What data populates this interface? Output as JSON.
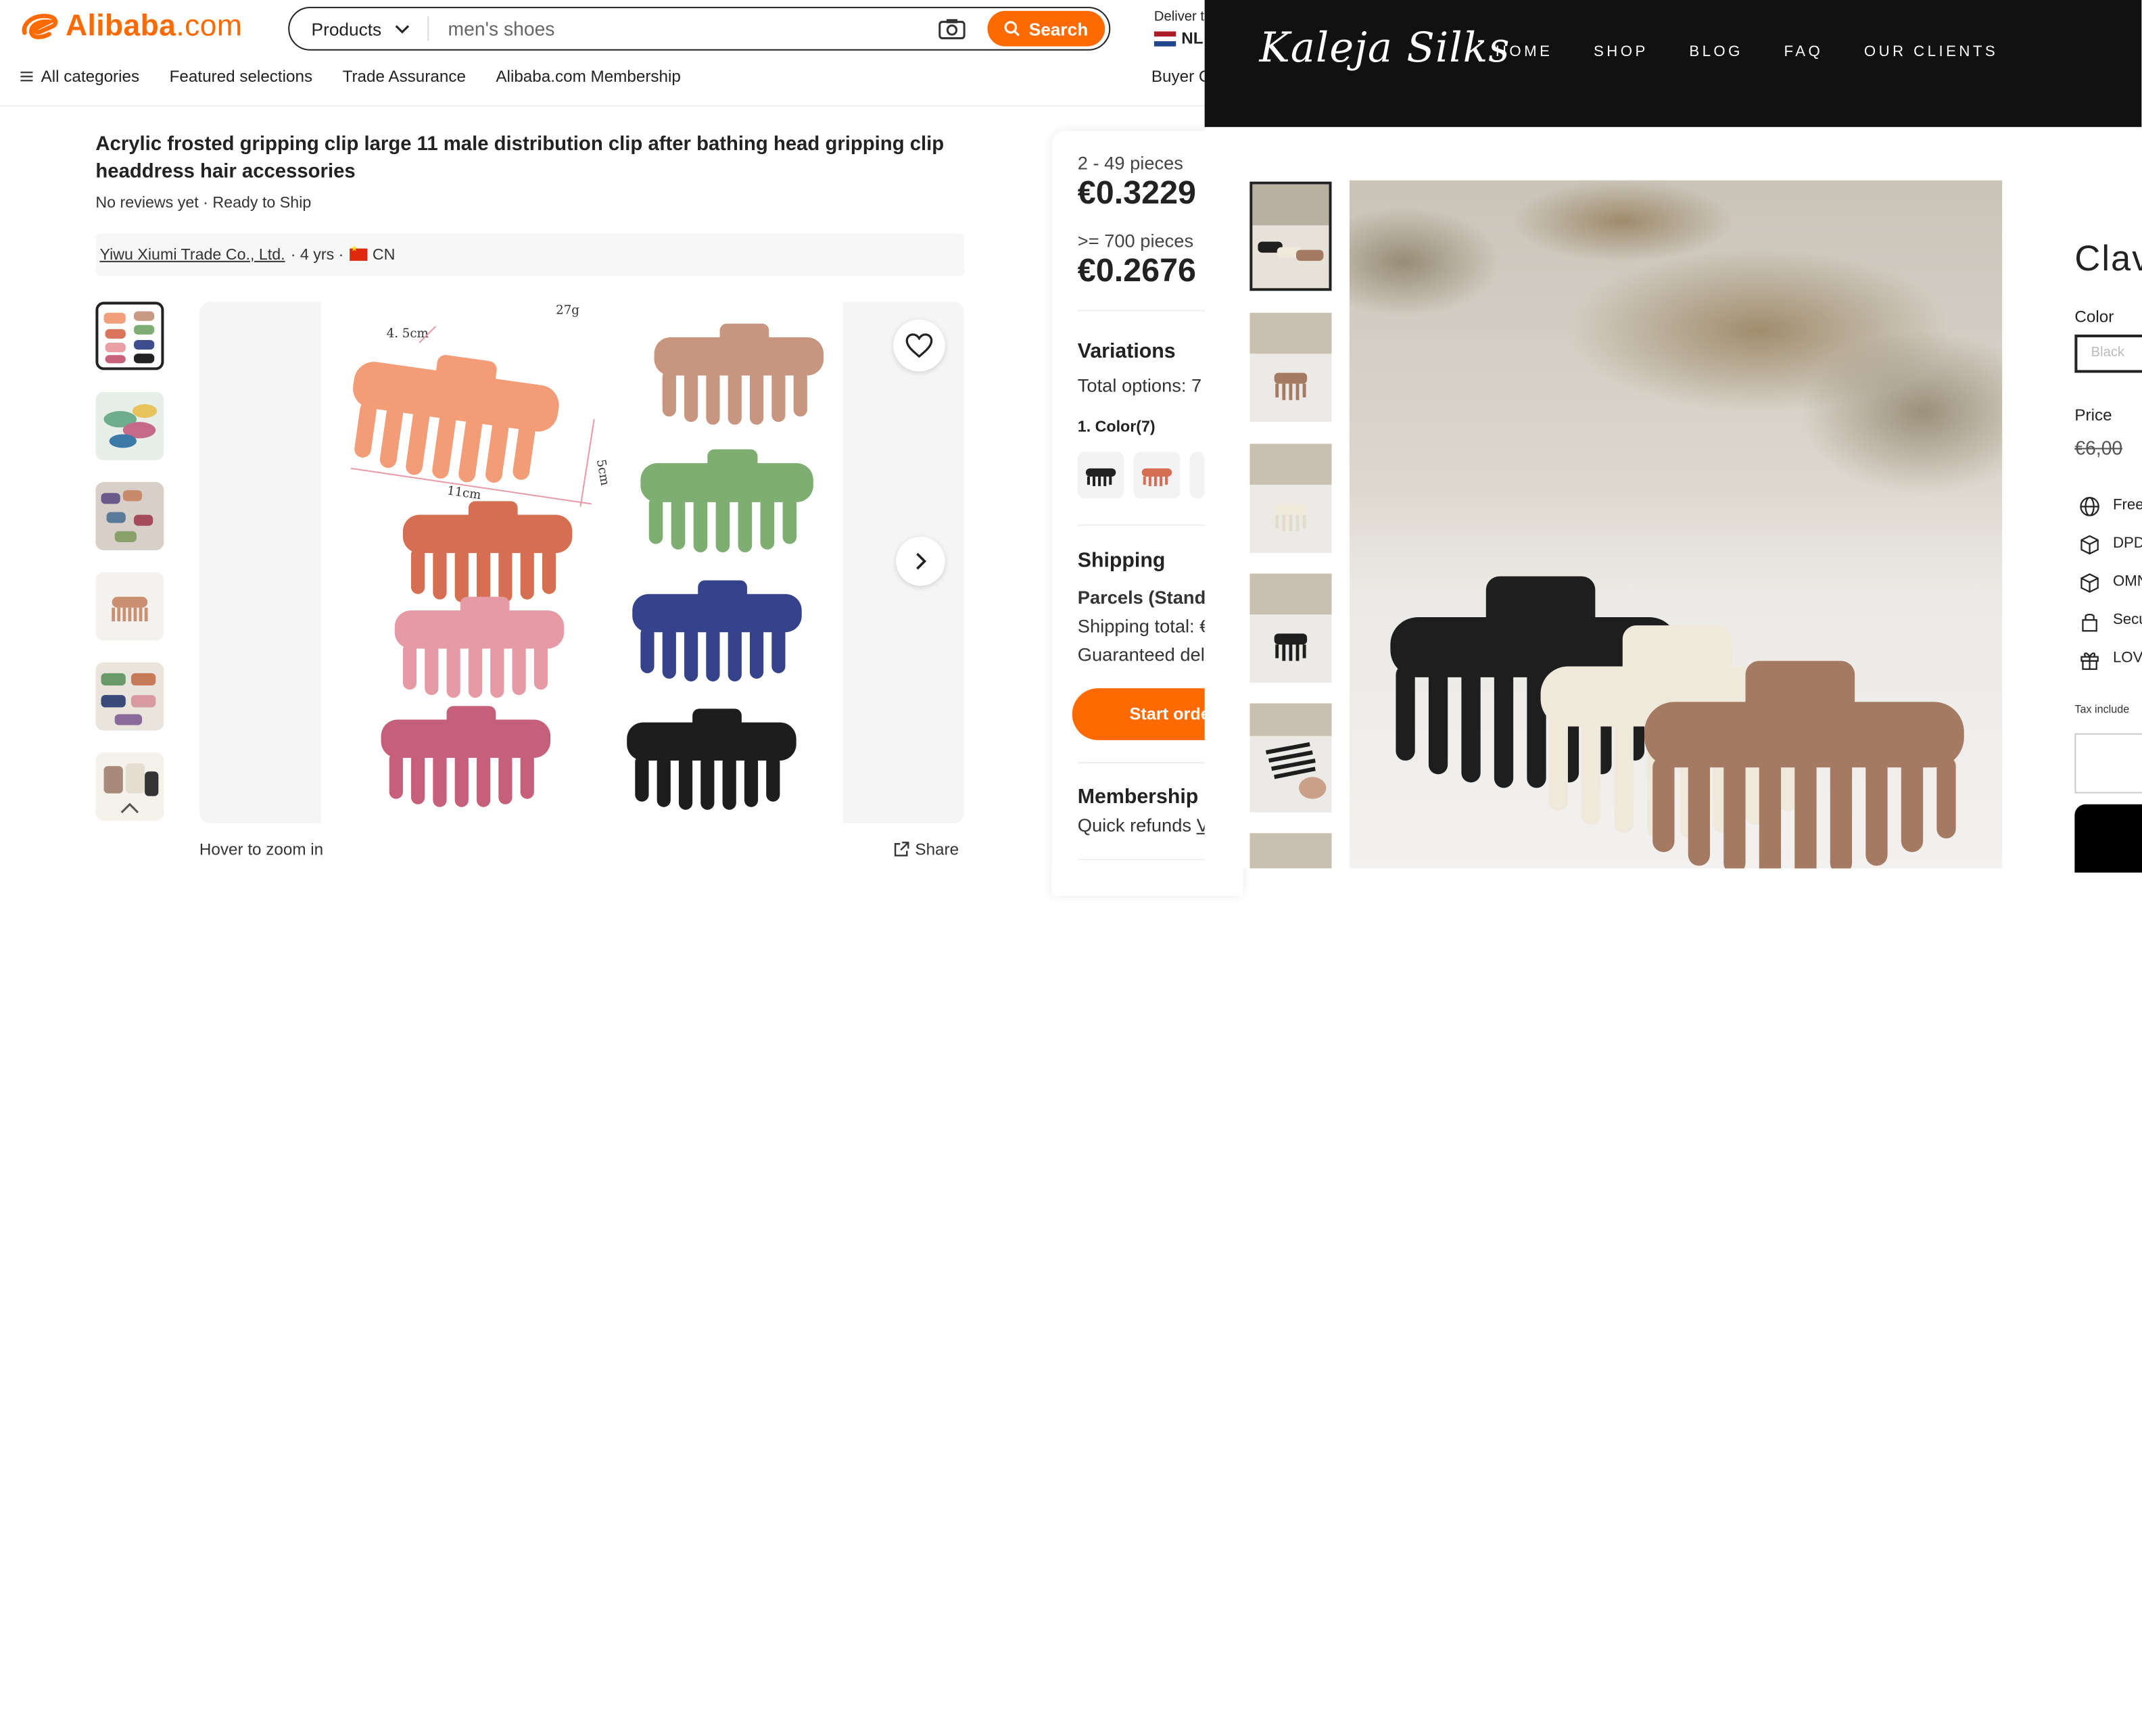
{
  "alibaba": {
    "logo_text": "Alibaba",
    "logo_suffix": ".com",
    "search": {
      "category": "Products",
      "value": "men's shoes",
      "button": "Search"
    },
    "deliver": {
      "label": "Deliver t",
      "country": "NL"
    },
    "nav": {
      "all_categories": "All categories",
      "items": [
        "Featured selections",
        "Trade Assurance",
        "Alibaba.com Membership"
      ],
      "buyer": "Buyer C"
    },
    "product": {
      "title": "Acrylic frosted gripping clip large 11 male distribution clip after bathing head gripping clip headdress hair accessories",
      "subline": "No reviews yet · Ready to Ship",
      "supplier_name": "Yiwu Xiumi Trade Co., Ltd.",
      "supplier_years": "· 4 yrs ·",
      "supplier_country": "CN",
      "hover_text": "Hover to zoom in",
      "share_text": "Share",
      "image_labels": {
        "weight": "27g",
        "width": "4. 5cm",
        "length": "11cm",
        "height": "5cm"
      }
    },
    "pricing": {
      "tier1": "2 - 49 pieces",
      "price1": "€0.3229",
      "tier2": ">= 700 pieces",
      "price2": "€0.2676"
    },
    "variations": {
      "title": "Variations",
      "total": "Total options: 7",
      "color_label": "1. Color(7)"
    },
    "shipping": {
      "title": "Shipping",
      "method": "Parcels (Standa",
      "total": "Shipping total: €",
      "guaranteed": "Guaranteed deli",
      "start_order": "Start orde"
    },
    "membership": {
      "title": "Membership b",
      "quick_refunds": "Quick refunds",
      "quick_refunds_link": "V"
    }
  },
  "kaleja": {
    "logo": "Kaleja Silks",
    "nav": [
      "HOME",
      "SHOP",
      "BLOG",
      "FAQ",
      "OUR CLIENTS"
    ],
    "product_title": "Clav",
    "color_label": "Color",
    "color_value": "Black",
    "price_label": "Price",
    "price_value": "€6,00",
    "features": [
      "Free",
      "DPD",
      "OMN",
      "Secu",
      "LOV"
    ],
    "tax_note": "Tax include"
  },
  "colors": {
    "alibaba_orange": "#ff6a00",
    "kaleja_header": "#111111",
    "clip_black": "#1e1e1e",
    "clip_cream": "#efe9dc",
    "clip_brown": "#a57a63"
  }
}
